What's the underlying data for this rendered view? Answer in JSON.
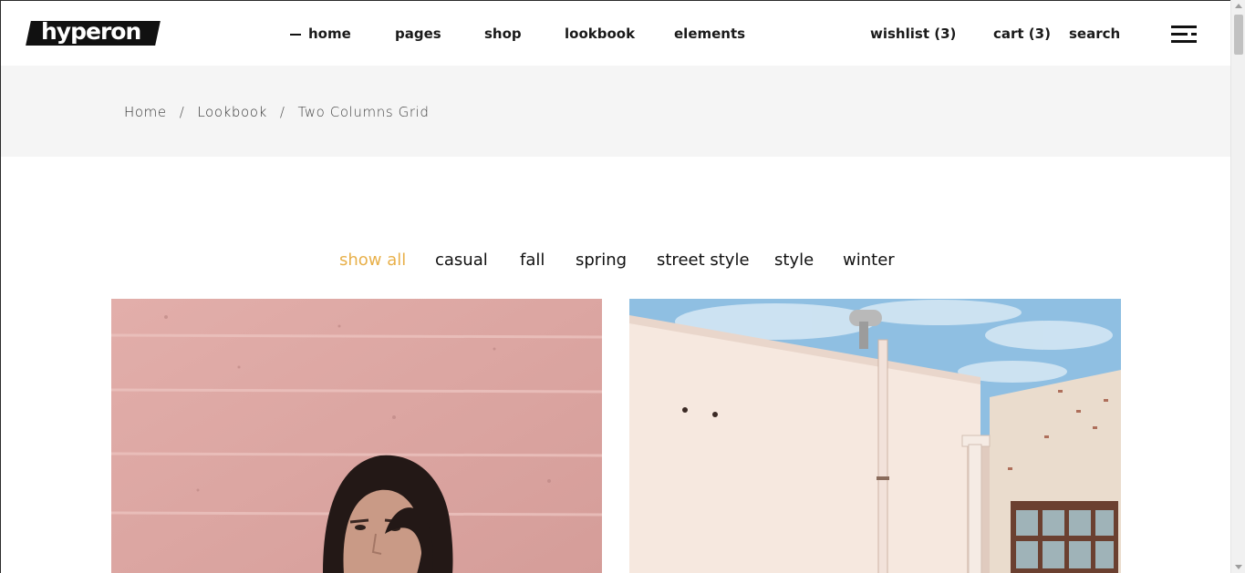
{
  "header": {
    "logo": "hyperon",
    "nav": [
      {
        "label": "home",
        "active": true
      },
      {
        "label": "pages",
        "active": false
      },
      {
        "label": "shop",
        "active": false
      },
      {
        "label": "lookbook",
        "active": false
      },
      {
        "label": "elements",
        "active": false
      }
    ],
    "wishlist": "wishlist (3)",
    "cart": "cart (3)",
    "search": "search",
    "menu_icon": "hamburger-menu-icon"
  },
  "breadcrumb": {
    "items": [
      "Home",
      "Lookbook",
      "Two Columns Grid"
    ],
    "separator": "/"
  },
  "filters": {
    "items": [
      "show all",
      "casual",
      "fall",
      "spring",
      "street style",
      "style",
      "winter"
    ],
    "active": "show all",
    "active_color": "#e8b04a"
  },
  "gallery": {
    "items": [
      {
        "subject": "woman-pink-wall-photo"
      },
      {
        "subject": "white-building-blue-sky-photo"
      }
    ]
  },
  "colors": {
    "breadcrumb_band": "#f5f5f5",
    "accent": "#e8b04a",
    "text": "#111111"
  }
}
